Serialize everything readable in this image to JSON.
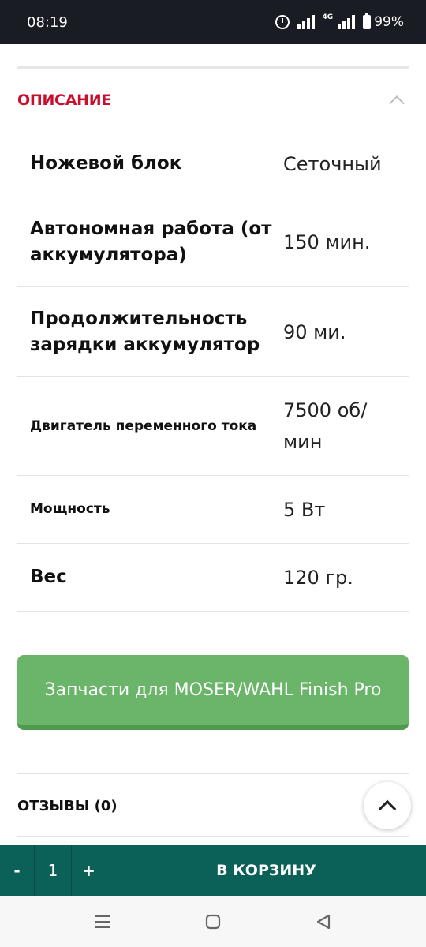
{
  "status_bar": {
    "time": "08:19",
    "network": "4G",
    "battery": "99%"
  },
  "description": {
    "title": "ОПИСАНИЕ",
    "specs": [
      {
        "name": "Ножевой блок",
        "value": "Сеточный"
      },
      {
        "name": "Автономная работа (от аккумулятора)",
        "value": "150 мин."
      },
      {
        "name": "Продолжительность зарядки аккумулятор",
        "value": "90 ми."
      },
      {
        "name": "Двигатель переменного тока",
        "value": "7500 об/мин"
      },
      {
        "name": "Мощность",
        "value": "5 Вт"
      },
      {
        "name": "Вес",
        "value": "120 гр."
      }
    ]
  },
  "parts_button": {
    "label": "Запчасти для MOSER/WAHL Finish Pro"
  },
  "reviews": {
    "label": "ОТЗЫВЫ (0)"
  },
  "cart_bar": {
    "minus": "-",
    "quantity": "1",
    "plus": "+",
    "add_to_cart": "В КОРЗИНУ"
  },
  "icons": {
    "collapse": "chevron-up-icon",
    "scroll_top": "chevron-up-icon",
    "nav_recent": "menu-icon",
    "nav_home": "home-icon",
    "nav_back": "back-icon"
  },
  "colors": {
    "accent_red": "#c8102e",
    "green_button": "#6bb56a",
    "cart_bar": "#0b6057"
  }
}
